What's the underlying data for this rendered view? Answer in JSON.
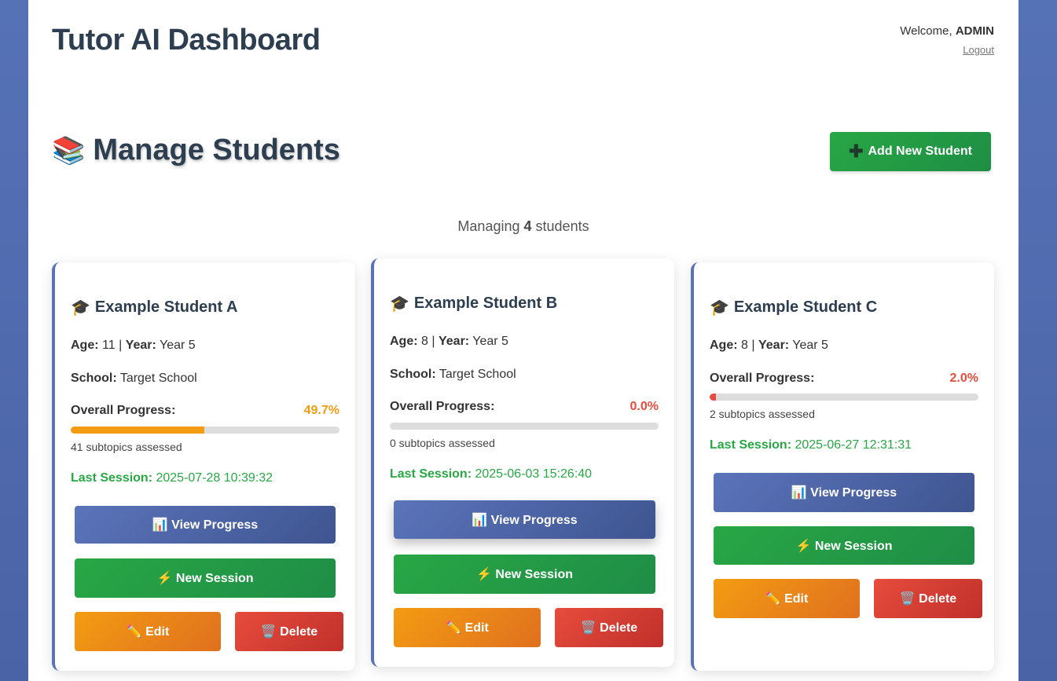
{
  "header": {
    "title": "Tutor AI Dashboard",
    "welcome_prefix": "Welcome,",
    "username": "ADMIN",
    "logout_label": "Logout"
  },
  "section": {
    "icon": "📚",
    "title": "Manage Students",
    "add_icon": "➕",
    "add_label": "Add New Student"
  },
  "summary": {
    "prefix": "Managing",
    "count": "4",
    "suffix": "students"
  },
  "labels": {
    "age": "Age:",
    "year": "Year:",
    "school": "School:",
    "overall_progress": "Overall Progress:",
    "last_session": "Last Session:",
    "separator": "|"
  },
  "buttons": {
    "view_progress": "📊 View Progress",
    "new_session": "⚡ New Session",
    "edit": "✏️ Edit",
    "delete": "🗑️ Delete"
  },
  "colors": {
    "accent": "#5a73b8",
    "success": "#28a745",
    "warning": "#f39c12",
    "danger": "#e74c3c"
  },
  "students": [
    {
      "icon": "🎓",
      "name": "Example Student A",
      "age": "11",
      "year": "Year 5",
      "school": "Target School",
      "progress": "49.7%",
      "progress_value": 49.7,
      "progress_color": "#f39c12",
      "assessed": "41 subtopics assessed",
      "last_session": "2025-07-28 10:39:32"
    },
    {
      "icon": "🎓",
      "name": "Example Student B",
      "age": "8",
      "year": "Year 5",
      "school": "Target School",
      "progress": "0.0%",
      "progress_value": 0,
      "progress_color": "#e74c3c",
      "assessed": "0 subtopics assessed",
      "last_session": "2025-06-03 15:26:40"
    },
    {
      "icon": "🎓",
      "name": "Example Student C",
      "age": "8",
      "year": "Year 5",
      "progress": "2.0%",
      "progress_value": 2,
      "progress_color": "#e74c3c",
      "assessed": "2 subtopics assessed",
      "last_session": "2025-06-27 12:31:31"
    }
  ]
}
